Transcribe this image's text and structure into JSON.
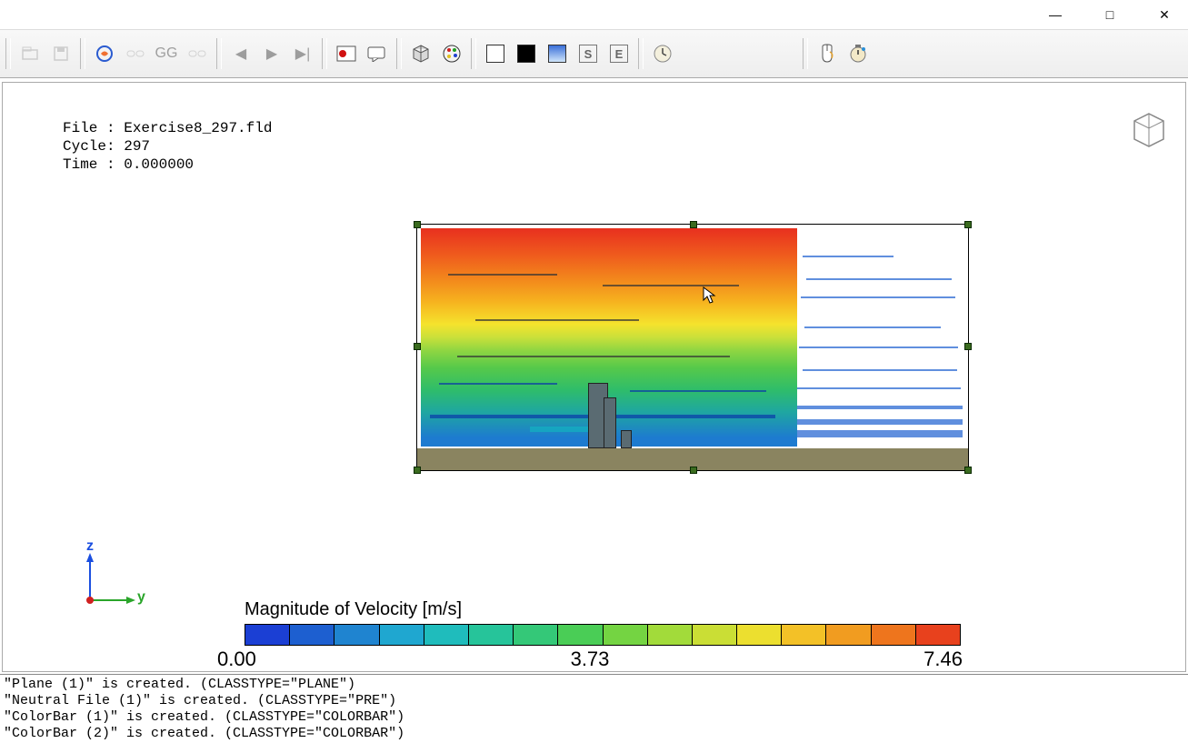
{
  "window": {
    "minimize": "—",
    "maximize": "□",
    "close": "✕"
  },
  "toolbar": {
    "icons": [
      "open-icon",
      "save-icon",
      "preview-icon",
      "link-a-icon",
      "link-b-icon",
      "play-icon",
      "step-back-icon",
      "step-forward-icon",
      "record-icon",
      "comment-icon",
      "cube-icon",
      "palette-icon",
      "white-icon",
      "black-icon",
      "gradient-icon",
      "s-icon",
      "e-icon",
      "clock-icon",
      "mouse-icon",
      "timer-icon"
    ]
  },
  "fileinfo": {
    "file_label": "File :",
    "file_value": "Exercise8_297.fld",
    "cycle_label": "Cycle:",
    "cycle_value": "297",
    "time_label": "Time :",
    "time_value": "0.000000"
  },
  "axis": {
    "z": "z",
    "y": "y"
  },
  "colorbar": {
    "title": "Magnitude of Velocity [m/s]",
    "min": "0.00",
    "mid": "3.73",
    "max": "7.46",
    "colors": [
      "#1b3fd4",
      "#1d5fd0",
      "#1f84d0",
      "#1fa7d0",
      "#1fbcbc",
      "#26c49a",
      "#34c878",
      "#4acd56",
      "#74d442",
      "#a2db3a",
      "#cade35",
      "#ecdf2f",
      "#f3c127",
      "#f19c20",
      "#ee751d",
      "#e8411d"
    ]
  },
  "log": {
    "lines": [
      "\"Plane (1)\" is created. (CLASSTYPE=\"PLANE\")",
      "\"Neutral File (1)\" is created. (CLASSTYPE=\"PRE\")",
      "\"ColorBar (1)\" is created. (CLASSTYPE=\"COLORBAR\")",
      "\"ColorBar (2)\" is created. (CLASSTYPE=\"COLORBAR\")"
    ]
  },
  "chart_data": {
    "type": "heatmap",
    "title": "Magnitude of Velocity [m/s]",
    "field": "velocity_magnitude",
    "units": "m/s",
    "range": [
      0.0,
      7.46
    ],
    "midpoint": 3.73,
    "orientation": "yz-plane",
    "notes": "Contour plot of velocity magnitude on a vertical plane; left portion shows colored contours (high velocity red at top ~7.46 m/s grading to low blue near ground ~0), right portion shows streamlines on white background around a central building obstacle."
  }
}
